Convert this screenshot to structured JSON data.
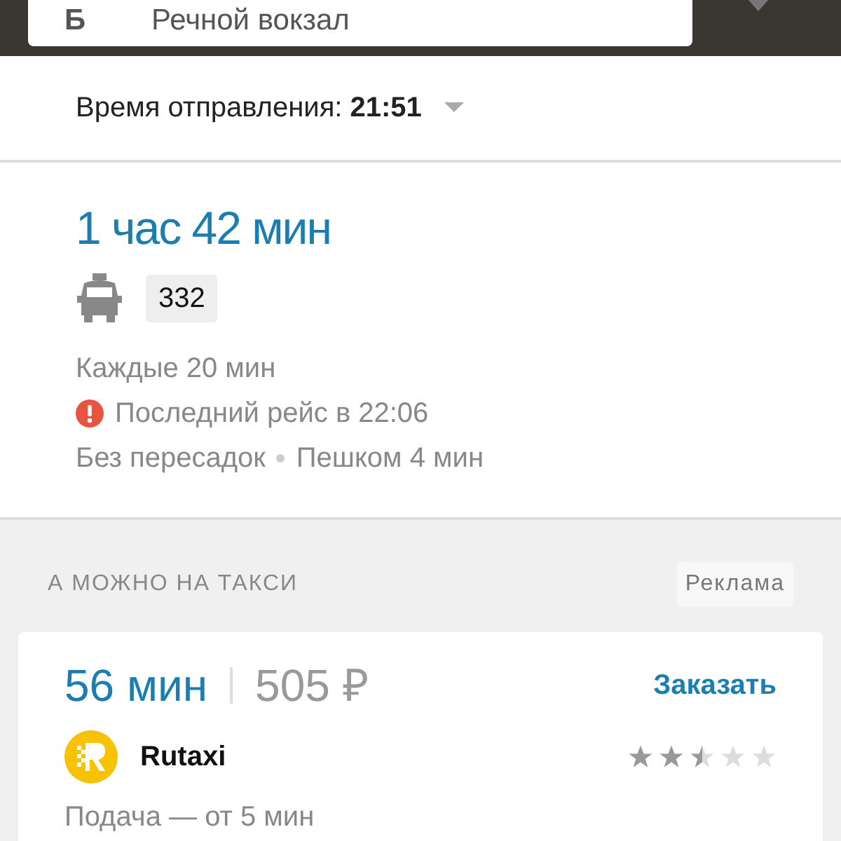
{
  "search_bar": {
    "point_letter": "Б",
    "value": "Речной вокзал"
  },
  "departure": {
    "label": "Время отправления:",
    "time": "21:51"
  },
  "route": {
    "duration": "1 час 42 мин",
    "number": "332",
    "frequency": "Каждые 20 мин",
    "warning": "Последний рейс в 22:06",
    "transfers": "Без пересадок",
    "walk": "Пешком 4 мин"
  },
  "taxi_section": {
    "heading": "А МОЖНО НА ТАКСИ",
    "ad_label": "Реклама",
    "offer": {
      "duration": "56 мин",
      "price": "505 ₽",
      "action": "Заказать",
      "company": "Rutaxi",
      "stars": 2.5,
      "pickup": "Подача — от 5 мин"
    }
  }
}
